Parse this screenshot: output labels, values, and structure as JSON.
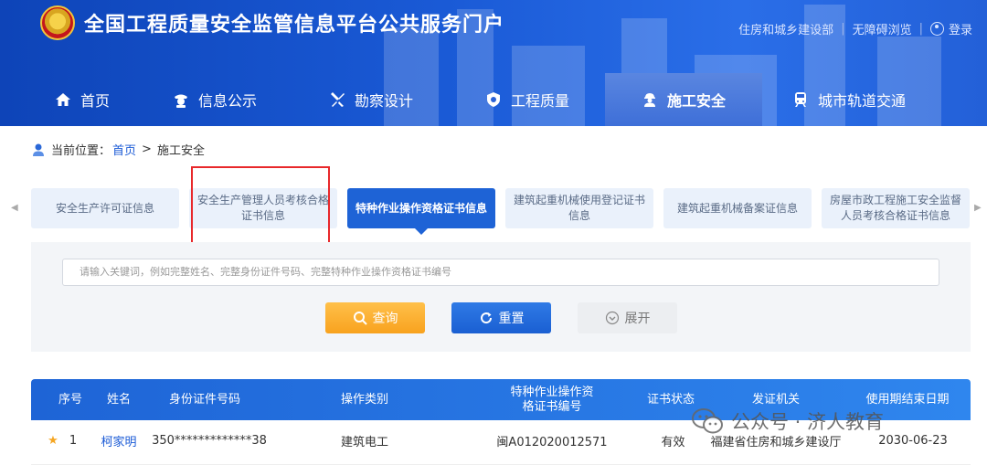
{
  "header": {
    "site_title": "全国工程质量安全监管信息平台公共服务门户",
    "links": [
      "住房和城乡建设部",
      "无障碍浏览"
    ],
    "login": "登录"
  },
  "nav": {
    "items": [
      {
        "label": "首页",
        "icon": "home-icon"
      },
      {
        "label": "信息公示",
        "icon": "officer-icon"
      },
      {
        "label": "勘察设计",
        "icon": "tools-icon"
      },
      {
        "label": "工程质量",
        "icon": "shield-icon"
      },
      {
        "label": "施工安全",
        "icon": "worker-icon",
        "active": true
      },
      {
        "label": "城市轨道交通",
        "icon": "train-icon"
      }
    ]
  },
  "breadcrumb": {
    "prefix": "当前位置：",
    "home": "首页",
    "separator": ">",
    "current": "施工安全"
  },
  "tabs": [
    {
      "label": "安全生产许可证信息"
    },
    {
      "label": "安全生产管理人员考核合格证书信息",
      "highlighted": true
    },
    {
      "label": "特种作业操作资格证书信息",
      "active": true
    },
    {
      "label": "建筑起重机械使用登记证书信息"
    },
    {
      "label": "建筑起重机械备案证信息"
    },
    {
      "label": "房屋市政工程施工安全监督人员考核合格证书信息"
    }
  ],
  "search": {
    "placeholder": "请输入关键词，例如完整姓名、完整身份证件号码、完整特种作业操作资格证书编号",
    "query_label": "查询",
    "reset_label": "重置",
    "expand_label": "展开"
  },
  "table": {
    "columns": [
      "序号",
      "姓名",
      "身份证件号码",
      "操作类别",
      "特种作业操作资格证书编号",
      "证书状态",
      "发证机关",
      "使用期结束日期"
    ],
    "rows": [
      {
        "index": "1",
        "name": "柯家明",
        "id_number": "350*************38",
        "category": "建筑电工",
        "cert_number": "闽A012020012571",
        "status": "有效",
        "issuer": "福建省住房和城乡建设厅",
        "end_date": "2030-06-23"
      }
    ]
  },
  "watermark": {
    "text": "公众号 · 济人教育"
  },
  "colors": {
    "header_blue": "#1a5ad6",
    "active_tab": "#1e63d6",
    "query_orange": "#f8a21e",
    "highlight_red": "#e8282b"
  }
}
